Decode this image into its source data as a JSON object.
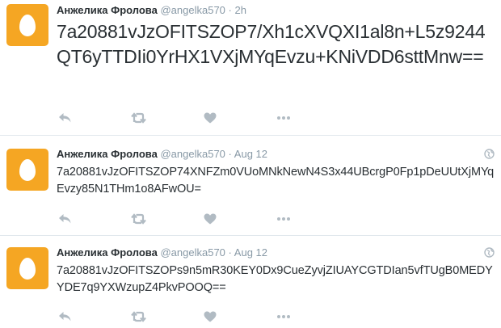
{
  "tweets": [
    {
      "name": "Анжелика Фролова",
      "handle": "@angelka570",
      "separator": "·",
      "time": "2h",
      "text": "7a20881vJzOFITSZOP7/Xh1cXVQXI1al8n+L5z9244QT6yTTDIi0YrHX1VXjMYqEvzu+KNiVDD6sttMnw=="
    },
    {
      "name": "Анжелика Фролова",
      "handle": "@angelka570",
      "separator": "·",
      "time": "Aug 12",
      "text": "7a20881vJzOFITSZOP74XNFZm0VUoMNkNewN4S3x44UBcrgP0Fp1pDeUUtXjMYqEvzy85N1THm1o8AFwOU="
    },
    {
      "name": "Анжелика Фролова",
      "handle": "@angelka570",
      "separator": "·",
      "time": "Aug 12",
      "text": "7a20881vJzOFITSZOPs9n5mR30KEY0Dx9CueZyvjZIUAYCGTDIan5vfTUgB0MEDYYDE7q9YXWzupZ4PkvPOOQ=="
    }
  ],
  "icons": {
    "avatar": "default-egg-avatar",
    "reply": "reply-icon",
    "retweet": "retweet-icon",
    "like": "heart-icon",
    "more": "more-icon",
    "globe": "globe-icon"
  },
  "colors": {
    "avatar_bg": "#f5a623",
    "name": "#292f33",
    "meta": "#8899a6",
    "icon": "#b1bbc3"
  }
}
